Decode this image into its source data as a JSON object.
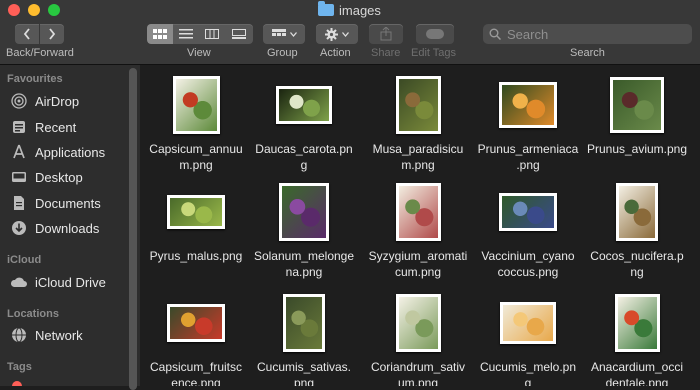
{
  "window": {
    "title": "images"
  },
  "toolbar": {
    "back_forward_label": "Back/Forward",
    "view_label": "View",
    "group_label": "Group",
    "action_label": "Action",
    "share_label": "Share",
    "edit_tags_label": "Edit Tags",
    "search_label": "Search",
    "search_placeholder": "Search"
  },
  "sidebar": {
    "favourites_header": "Favourites",
    "favourites": [
      "AirDrop",
      "Recent",
      "Applications",
      "Desktop",
      "Documents",
      "Downloads"
    ],
    "icloud_header": "iCloud",
    "icloud": [
      "iCloud Drive"
    ],
    "locations_header": "Locations",
    "locations": [
      "Network"
    ],
    "tags_header": "Tags"
  },
  "files": [
    {
      "line1": "Capsicum_annuu",
      "line2": "m.png",
      "colors": [
        "#f4f1e6",
        "#5d8a3a",
        "#c23b22"
      ]
    },
    {
      "line1": "Daucas_carota.pn",
      "line2": "g",
      "colors": [
        "#1a2410",
        "#7fa24a",
        "#dfe6c8"
      ]
    },
    {
      "line1": "Musa_paradisicu",
      "line2": "m.png",
      "colors": [
        "#3b4a25",
        "#7a8a3a",
        "#8a6a3a"
      ]
    },
    {
      "line1": "Prunus_armeniaca",
      "line2": ".png",
      "colors": [
        "#2f4a1f",
        "#e08a2a",
        "#f0b24a"
      ]
    },
    {
      "line1": "Prunus_avium.png",
      "line2": "",
      "colors": [
        "#3a5a2a",
        "#6a8a4a",
        "#5a2a2a"
      ]
    },
    {
      "line1": "Pyrus_malus.png",
      "line2": "",
      "colors": [
        "#4a6a2a",
        "#9ab84a",
        "#c8d87a"
      ]
    },
    {
      "line1": "Solanum_melonge",
      "line2": "na.png",
      "colors": [
        "#3a6a2a",
        "#5a2a6a",
        "#8a4aa0"
      ]
    },
    {
      "line1": "Syzygium_aromati",
      "line2": "cum.png",
      "colors": [
        "#f2ede0",
        "#b04a4a",
        "#6a8a4a"
      ]
    },
    {
      "line1": "Vaccinium_cyano",
      "line2": "coccus.png",
      "colors": [
        "#2f5a2a",
        "#3a4a8a",
        "#6a8ab8"
      ]
    },
    {
      "line1": "Cocos_nucifera.p",
      "line2": "ng",
      "colors": [
        "#f3efe3",
        "#8a6a3a",
        "#4a6a3a"
      ]
    },
    {
      "line1": "Capsicum_fruitsc",
      "line2": "ence.png",
      "colors": [
        "#3a4a2a",
        "#c83a2a",
        "#e0a030"
      ]
    },
    {
      "line1": "Cucumis_sativas.",
      "line2": "png",
      "colors": [
        "#3a4a2a",
        "#6a7a3a",
        "#8a9a5a"
      ]
    },
    {
      "line1": "Coriandrum_sativ",
      "line2": "um.png",
      "colors": [
        "#f4f1e6",
        "#7a9a5a",
        "#c0c8a0"
      ]
    },
    {
      "line1": "Cucumis_melo.pn",
      "line2": "g",
      "colors": [
        "#f0ead8",
        "#e8a84a",
        "#f4c878"
      ]
    },
    {
      "line1": "Anacardium_occi",
      "line2": "dentale.png",
      "colors": [
        "#f4f0e4",
        "#3a7a3a",
        "#d84a2a"
      ]
    }
  ]
}
